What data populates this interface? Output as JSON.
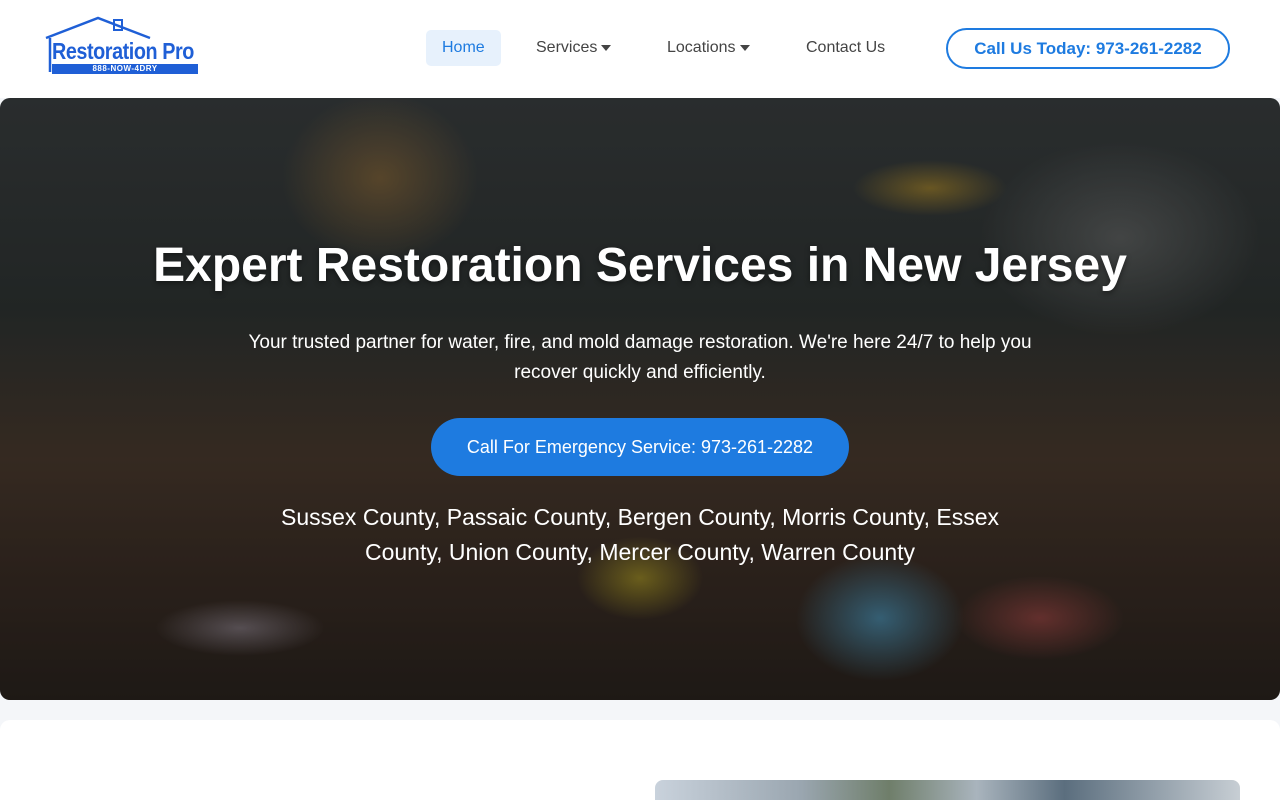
{
  "logo": {
    "brand": "Restoration Pro",
    "phone": "888-NOW-4DRY"
  },
  "nav": {
    "items": [
      {
        "label": "Home",
        "active": true
      },
      {
        "label": "Services",
        "dropdown": true
      },
      {
        "label": "Locations",
        "dropdown": true
      },
      {
        "label": "Contact Us"
      }
    ]
  },
  "header_cta": "Call Us Today: 973-261-2282",
  "hero": {
    "title": "Expert Restoration Services in New Jersey",
    "subtitle": "Your trusted partner for water, fire, and mold damage restoration. We're here 24/7 to help you recover quickly and efficiently.",
    "button": "Call For Emergency Service: 973-261-2282",
    "counties": "Sussex County, Passaic County, Bergen County, Morris County, Essex County, Union County, Mercer County, Warren County"
  },
  "colors": {
    "accent": "#1e7be0",
    "logo_blue": "#1f5fd6",
    "nav_active_bg": "#e7f1fc"
  }
}
